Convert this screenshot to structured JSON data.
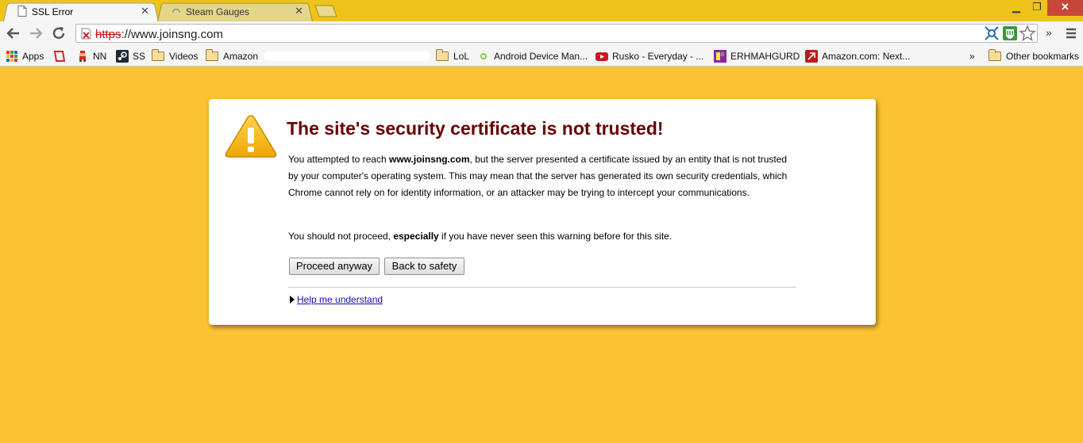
{
  "tabs": [
    {
      "title": "SSL Error",
      "active": true
    },
    {
      "title": "Steam Gauges",
      "active": false
    }
  ],
  "toolbar": {
    "url_scheme": "https",
    "url_rest": "://www.joinsng.com"
  },
  "bookmarks": {
    "apps_label": "Apps",
    "items": [
      {
        "label": "NN"
      },
      {
        "label": "SS"
      },
      {
        "label": "Videos"
      },
      {
        "label": "Amazon"
      },
      {
        "label": "LoL"
      },
      {
        "label": "Android Device Man..."
      },
      {
        "label": "Rusko - Everyday - ..."
      },
      {
        "label": "ERHMAHGURD"
      },
      {
        "label": "Amazon.com: Next..."
      }
    ],
    "overflow": "»",
    "other": "Other bookmarks"
  },
  "interstitial": {
    "heading": "The site's security certificate is not trusted!",
    "p1_pre": "You attempted to reach ",
    "p1_host": "www.joinsng.com",
    "p1_post": ", but the server presented a certificate issued by an entity that is not trusted by your computer's operating system. This may mean that the server has generated its own security credentials, which Chrome cannot rely on for identity information, or an attacker may be trying to intercept your communications.",
    "p2_pre": "You should not proceed, ",
    "p2_bold": "especially",
    "p2_post": " if you have never seen this warning before for this site.",
    "proceed_label": "Proceed anyway",
    "back_label": "Back to safety",
    "help_label": "Help me understand"
  },
  "colors": {
    "page_bg": "#fbc233",
    "heading": "#660000",
    "link": "#1a0dab",
    "tabstrip": "#eec41a"
  }
}
